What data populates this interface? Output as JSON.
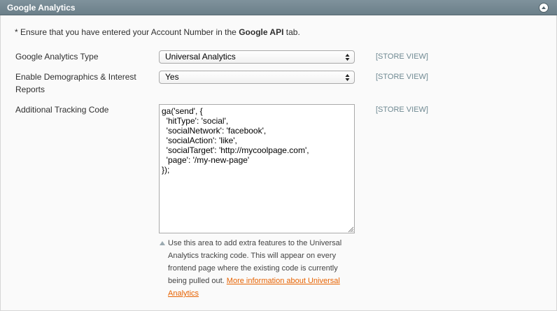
{
  "section": {
    "title": "Google Analytics",
    "collapse_icon": "collapse-up-icon"
  },
  "note": {
    "prefix": "* Ensure that you have entered your Account Number in the ",
    "bold": "Google API",
    "suffix": " tab."
  },
  "fields": {
    "type": {
      "label": "Google Analytics Type",
      "value": "Universal Analytics",
      "scope": "[STORE VIEW]"
    },
    "demographics": {
      "label": "Enable Demographics & Interest Reports",
      "value": "Yes",
      "scope": "[STORE VIEW]"
    },
    "tracking": {
      "label": "Additional Tracking Code",
      "value": "ga('send', {\n  'hitType': 'social',\n  'socialNetwork': 'facebook',\n  'socialAction': 'like',\n  'socialTarget': 'http://mycoolpage.com',\n  'page': '/my-new-page'\n});",
      "scope": "[STORE VIEW]",
      "hint": "Use this area to add extra features to the Universal Analytics tracking code. This will appear on every frontend page where the existing code is currently being pulled out. ",
      "hint_link": "More information about Universal Analytics"
    }
  },
  "colors": {
    "header": "#748892",
    "link": "#e76200",
    "scope": "#6f8992"
  }
}
